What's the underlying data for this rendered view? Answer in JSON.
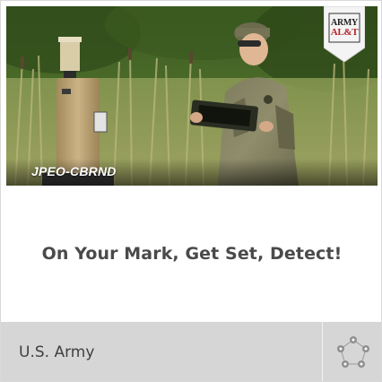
{
  "card": {
    "photo": {
      "caption": "JPEO-CBRND"
    },
    "logo": {
      "line1": "ARMY",
      "line2": "AL&T",
      "icon": "army-alt-magazine-logo"
    },
    "title": "On Your Mark, Get Set, Detect!",
    "footer": {
      "source": "U.S. Army",
      "icon": "cbrn-hazard-symbols-icon"
    }
  },
  "colors": {
    "footer_bg": "#d6d6d6",
    "title_text": "#4a4a4a",
    "caption_text": "#ffffff",
    "logo_red": "#b3262d"
  }
}
